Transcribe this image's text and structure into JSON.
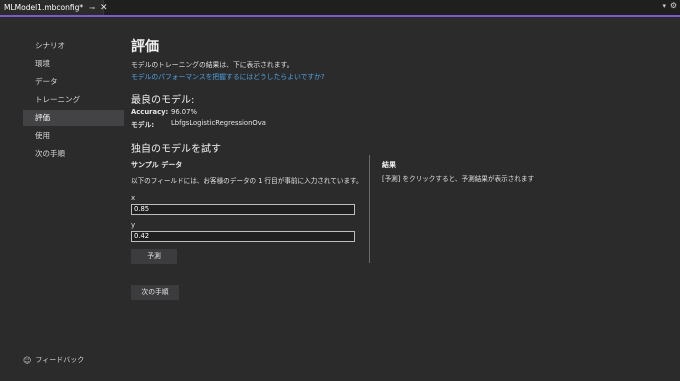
{
  "tab": {
    "title": "MLModel1.mbconfig*",
    "pin_icon": "pin-icon",
    "close_icon": "close-icon"
  },
  "sidebar": {
    "items": [
      {
        "label": "シナリオ",
        "active": false
      },
      {
        "label": "環境",
        "active": false
      },
      {
        "label": "データ",
        "active": false
      },
      {
        "label": "トレーニング",
        "active": false
      },
      {
        "label": "評価",
        "active": true
      },
      {
        "label": "使用",
        "active": false
      },
      {
        "label": "次の手順",
        "active": false
      }
    ],
    "feedback_label": "フィードバック"
  },
  "main": {
    "title": "評価",
    "description": "モデルのトレーニングの結果は、下に表示されます。",
    "help_link": "モデルのパフォーマンスを把握するにはどうしたらよいですか?",
    "best_model": {
      "heading": "最良のモデル:",
      "accuracy_label": "Accuracy:",
      "accuracy_value": "96.07%",
      "model_label": "モデル:",
      "model_value": "LbfgsLogisticRegressionOva"
    },
    "try_model": {
      "heading": "独自のモデルを試す",
      "sample_title": "サンプル データ",
      "sample_desc": "以下のフィールドには、お客様のデータの 1 行目が事前に入力されています。",
      "fields": [
        {
          "label": "x",
          "value": "0.85"
        },
        {
          "label": "y",
          "value": "0.42"
        }
      ],
      "predict_label": "予測",
      "result_title": "結果",
      "result_text": "[予測] をクリックすると、予測結果が表示されます"
    },
    "next_step_label": "次の手順"
  },
  "colors": {
    "background": "#2b2b2c",
    "accent": "#7b5cc9",
    "link": "#4fa3e3",
    "active_nav": "#434346"
  }
}
